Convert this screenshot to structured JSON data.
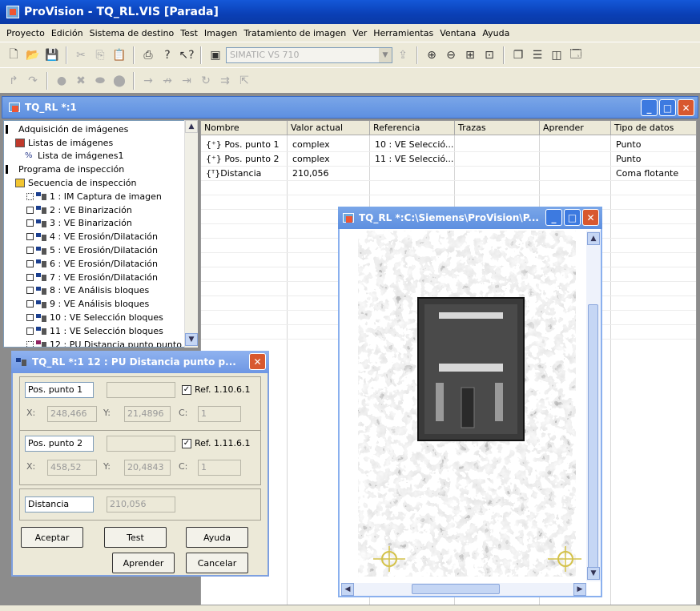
{
  "app": {
    "title": "ProVision - TQ_RL.VIS [Parada]",
    "icon": "provision-app-icon"
  },
  "menu": [
    "Proyecto",
    "Edición",
    "Sistema de destino",
    "Test",
    "Imagen",
    "Tratamiento de imagen",
    "Ver",
    "Herramientas",
    "Ventana",
    "Ayuda"
  ],
  "toolbar": {
    "device_combo": "SIMATIC VS 710"
  },
  "child_window": {
    "title": "TQ_RL *:1"
  },
  "tree": {
    "items": [
      {
        "label": "Adquisición de imágenes",
        "level": 0
      },
      {
        "label": "Listas de imágenes",
        "level": 1
      },
      {
        "label": "Lista de imágenes1",
        "level": 2
      },
      {
        "label": "Programa de inspección",
        "level": 0
      },
      {
        "label": "Secuencia de inspección",
        "level": 1
      },
      {
        "label": "1 : IM Captura de imagen",
        "level": 2
      },
      {
        "label": "2 : VE Binarización",
        "level": 2
      },
      {
        "label": "3 : VE Binarización",
        "level": 2
      },
      {
        "label": "4 : VE Erosión/Dilatación",
        "level": 2
      },
      {
        "label": "5 : VE Erosión/Dilatación",
        "level": 2
      },
      {
        "label": "6 : VE Erosión/Dilatación",
        "level": 2
      },
      {
        "label": "7 : VE Erosión/Dilatación",
        "level": 2
      },
      {
        "label": "8 : VE Análisis bloques",
        "level": 2
      },
      {
        "label": "9 : VE Análisis bloques",
        "level": 2
      },
      {
        "label": "10 : VE Selección bloques",
        "level": 2
      },
      {
        "label": "11 : VE Selección bloques",
        "level": 2
      },
      {
        "label": "12 : PU Distancia punto punto",
        "level": 2
      }
    ]
  },
  "table": {
    "headers": [
      "Nombre",
      "Valor actual",
      "Referencia",
      "Trazas",
      "Aprender",
      "Tipo de datos"
    ],
    "rows": [
      [
        "Pos. punto 1",
        "complex",
        "10 : VE Selecció...",
        "",
        "",
        "Punto"
      ],
      [
        "Pos. punto 2",
        "complex",
        "11 : VE Selecció...",
        "",
        "",
        "Punto"
      ],
      [
        "Distancia",
        "210,056",
        "",
        "",
        "",
        "Coma flotante"
      ]
    ]
  },
  "dialog": {
    "title": "TQ_RL *:1  12 : PU Distancia punto p...",
    "p1": {
      "name": "Pos. punto 1",
      "ref": "Ref. 1.10.6.1",
      "x_label": "X:",
      "x": "248,466",
      "y_label": "Y:",
      "y": "21,4896",
      "c_label": "C:",
      "c": "1"
    },
    "p2": {
      "name": "Pos. punto 2",
      "ref": "Ref. 1.11.6.1",
      "x_label": "X:",
      "x": "458,52",
      "y_label": "Y:",
      "y": "20,4843",
      "c_label": "C:",
      "c": "1"
    },
    "dist": {
      "name": "Distancia",
      "value": "210,056"
    },
    "buttons": {
      "accept": "Aceptar",
      "test": "Test",
      "help": "Ayuda",
      "learn": "Aprender",
      "cancel": "Cancelar"
    }
  },
  "image_window": {
    "title": "TQ_RL *:C:\\Siemens\\ProVision\\P..."
  }
}
